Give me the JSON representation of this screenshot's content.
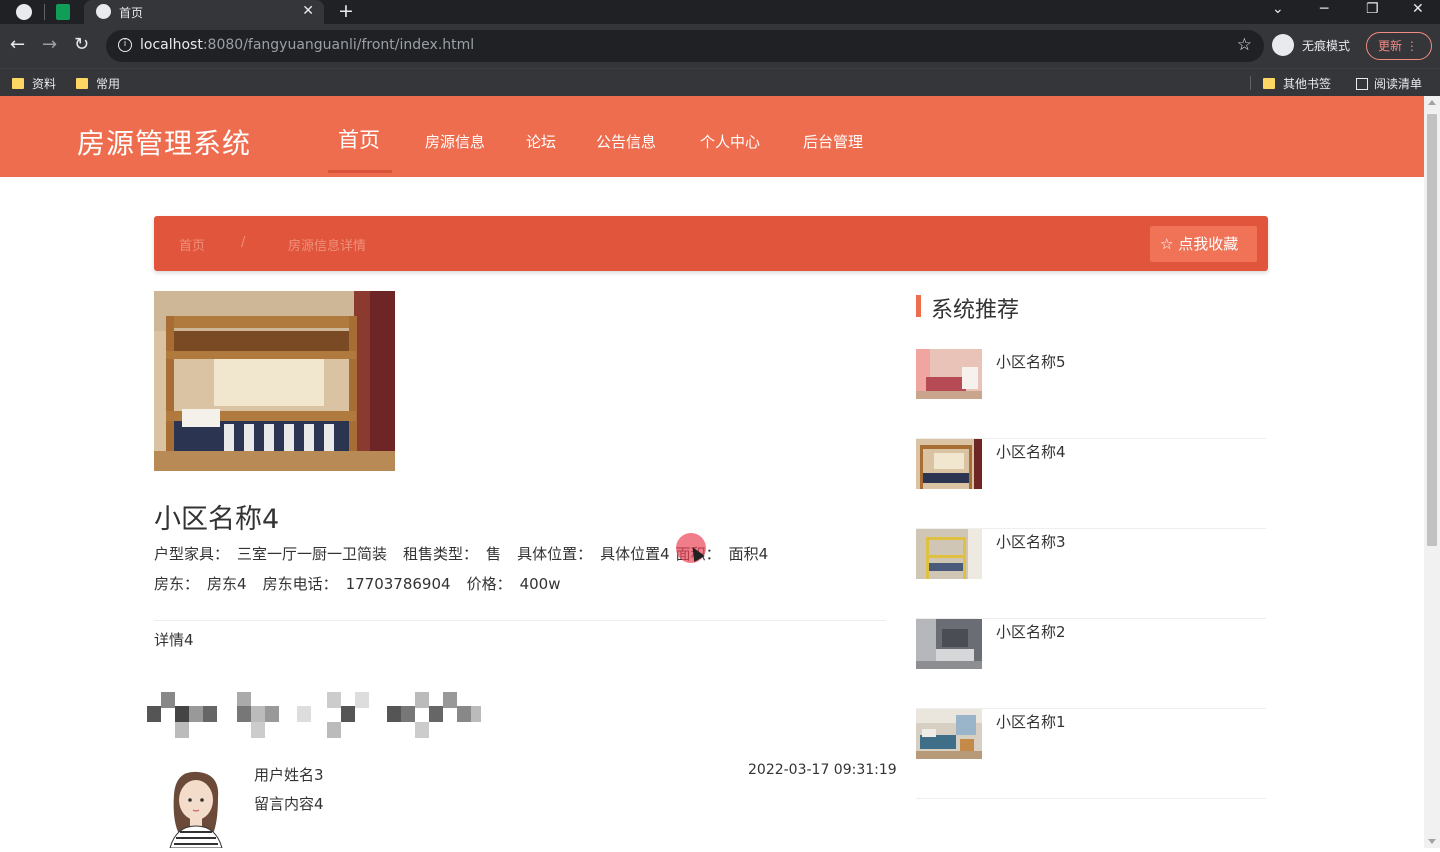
{
  "browser": {
    "tab_title": "首页",
    "url_host": "localhost",
    "url_rest": ":8080/fangyuanguanli/front/index.html",
    "incognito_label": "无痕模式",
    "update_label": "更新",
    "bookmarks": [
      "资料",
      "常用"
    ],
    "other_bookmarks": "其他书签",
    "reading_list": "阅读清单"
  },
  "site": {
    "logo": "房源管理系统",
    "nav": [
      "首页",
      "房源信息",
      "论坛",
      "公告信息",
      "个人中心",
      "后台管理"
    ],
    "accent_color": "#ef6d4f"
  },
  "breadcrumb": {
    "home": "首页",
    "separator": "/",
    "current": "房源信息详情",
    "favorite_button": "☆ 点我收藏"
  },
  "house": {
    "title": "小区名称4",
    "line1": [
      {
        "label": "户型家具：",
        "value": "三室一厅一厨一卫简装"
      },
      {
        "label": "租售类型：",
        "value": "售"
      },
      {
        "label": "具体位置：",
        "value": "具体位置4"
      },
      {
        "label": "面积：",
        "value": "面积4"
      }
    ],
    "line2": [
      {
        "label": "房东：",
        "value": "房东4"
      },
      {
        "label": "房东电话：",
        "value": "17703786904"
      },
      {
        "label": "价格：",
        "value": "400w"
      }
    ],
    "detail": "详情4"
  },
  "comment": {
    "user": "用户姓名3",
    "content": "留言内容4",
    "time": "2022-03-17 09:31:19"
  },
  "recommend": {
    "heading": "系统推荐",
    "items": [
      "小区名称5",
      "小区名称4",
      "小区名称3",
      "小区名称2",
      "小区名称1"
    ]
  }
}
